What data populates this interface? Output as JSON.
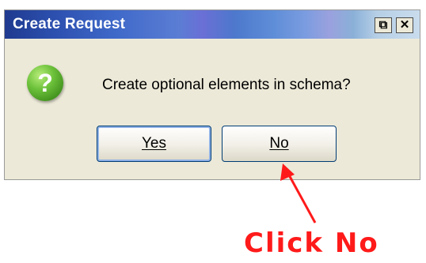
{
  "dialog": {
    "title": "Create Request",
    "restore_glyph": "⧉",
    "close_glyph": "✕",
    "icon": "question-icon",
    "icon_glyph": "?",
    "message": "Create optional elements in schema?",
    "buttons": {
      "yes": {
        "label": "Yes"
      },
      "no": {
        "label": "No"
      }
    }
  },
  "annotation": {
    "text": "Click No",
    "color": "#ff1a1a"
  },
  "colors": {
    "title_bar_start": "#1f3a8f",
    "dialog_background": "#ece9d8",
    "button_border": "#003c74"
  }
}
